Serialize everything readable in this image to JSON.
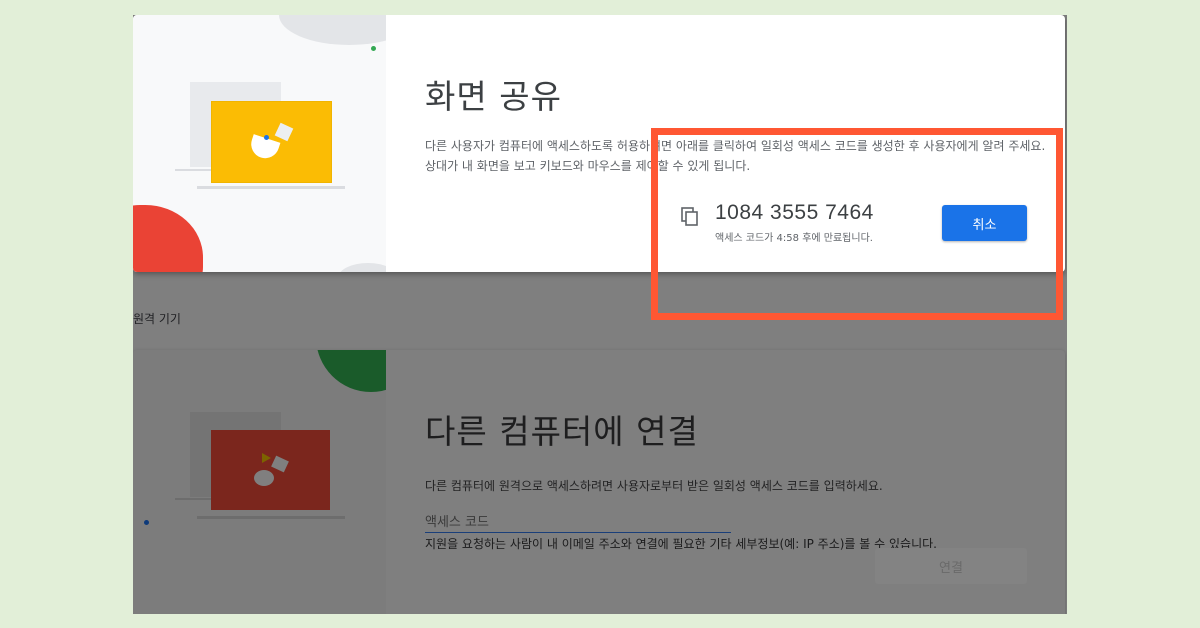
{
  "share": {
    "title": "화면 공유",
    "description": "다른 사용자가 컴퓨터에 액세스하도록 허용하려면 아래를 클릭하여 일회성 액세스 코드를 생성한 후 사용자에게 알려 주세요. 상대가 내 화면을 보고 키보드와 마우스를 제어할 수 있게 됩니다.",
    "access_code": "1084 3555 7464",
    "expiry_text": "액세스 코드가 4:58 후에 만료됩니다.",
    "cancel_label": "취소",
    "copy_icon": "copy-icon"
  },
  "section_label": "원격 기기",
  "connect": {
    "title": "다른 컴퓨터에 연결",
    "description": "다른 컴퓨터에 원격으로 액세스하려면 사용자로부터 받은 일회성 액세스 코드를 입력하세요.",
    "input_placeholder": "액세스 코드",
    "input_value": "",
    "info_text": "지원을 요청하는 사람이 내 이메일 주소와 연결에 필요한 기타 세부정보(예: IP 주소)를 볼 수 있습니다.",
    "connect_label": "연결"
  },
  "colors": {
    "accent": "#1a73e8",
    "highlight": "#ff5733",
    "page_background": "#e2efd8",
    "overlay": "#7f7f7f",
    "illustration_yellow": "#fbbc04",
    "illustration_red": "#ea4335"
  }
}
